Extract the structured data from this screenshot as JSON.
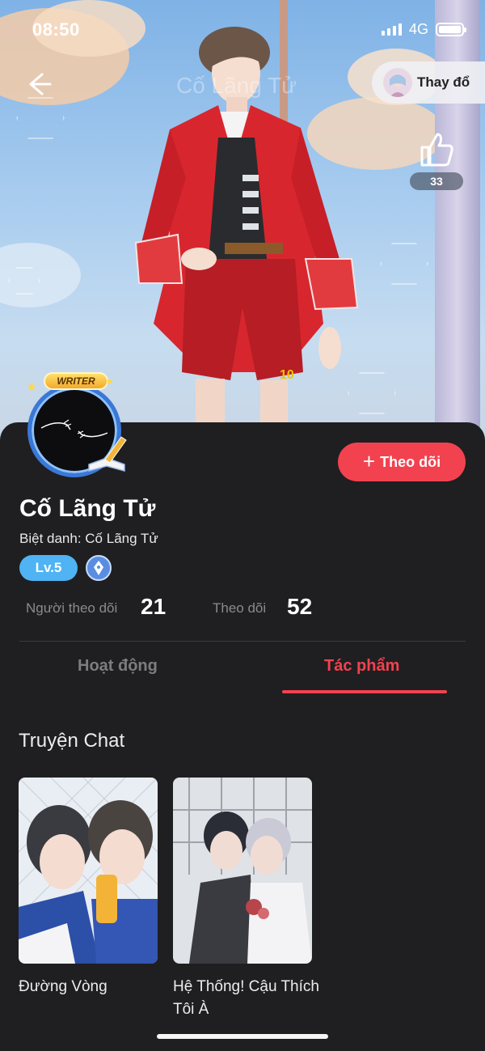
{
  "status_bar": {
    "time": "08:50",
    "network": "4G"
  },
  "header": {
    "faded_title": "Cố Lãng Tử",
    "change_outfit_label": "Thay đổ",
    "like_count": "33"
  },
  "profile": {
    "writer_badge": "WRITER",
    "name": "Cố Lãng Tử",
    "nickname": "Biệt danh: Cố Lãng Tử",
    "level": "Lv.5",
    "follow_button": "Theo dõi",
    "stats": [
      {
        "label": "Người theo dõi",
        "value": "21"
      },
      {
        "label": "Theo dõi",
        "value": "52"
      }
    ]
  },
  "tabs": [
    {
      "label": "Hoạt động",
      "active": false
    },
    {
      "label": "Tác phẩm",
      "active": true
    }
  ],
  "section": {
    "title": "Truyện Chat"
  },
  "works": [
    {
      "title": "Đường Vòng"
    },
    {
      "title": "Hệ Thống! Cậu Thích Tôi À"
    }
  ],
  "colors": {
    "accent": "#f2424f",
    "level_badge": "#4fb3f4",
    "background": "#1f1f21"
  },
  "icons": [
    "back-arrow-icon",
    "like-thumb-icon",
    "plus-icon",
    "pen-badge-icon"
  ]
}
